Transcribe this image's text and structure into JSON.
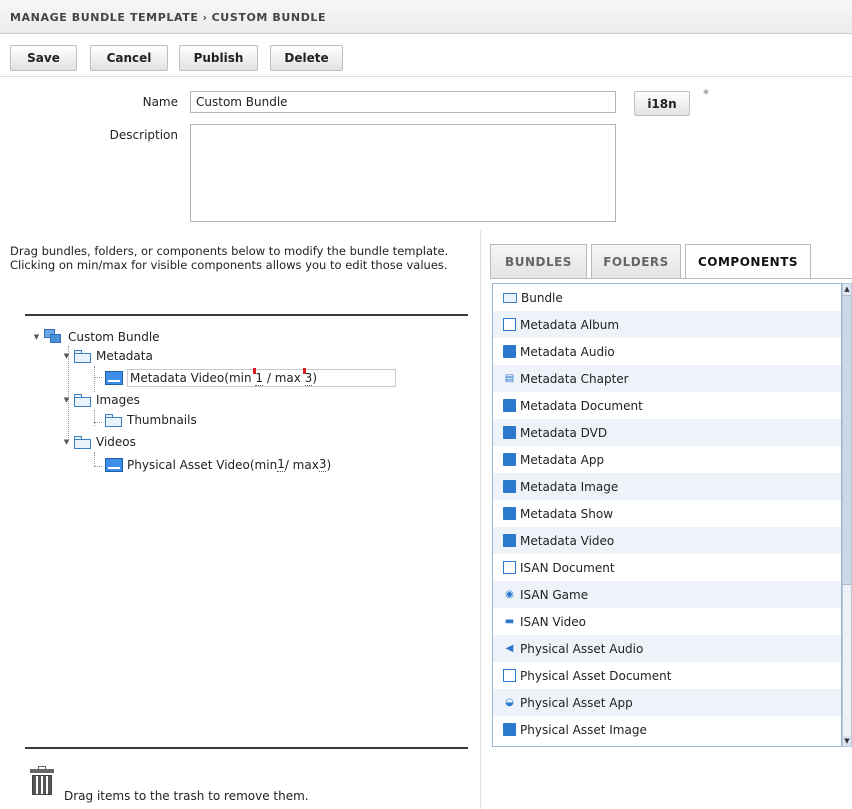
{
  "breadcrumb": {
    "parent": "MANAGE BUNDLE TEMPLATE",
    "separator": "›",
    "current": "CUSTOM BUNDLE"
  },
  "toolbar": {
    "save": "Save",
    "cancel": "Cancel",
    "publish": "Publish",
    "delete": "Delete"
  },
  "form": {
    "name_label": "Name",
    "name_value": "Custom Bundle",
    "i18n_label": "i18n",
    "required_mark": "*",
    "description_label": "Description",
    "description_value": ""
  },
  "instructions": "Drag bundles, folders, or components below to modify the bundle template. Clicking on min/max for visible components allows you to edit those values.",
  "tree": {
    "root": "Custom Bundle",
    "metadata": "Metadata",
    "metadata_video": {
      "prefix": "Metadata Video(min ",
      "min": "1",
      "sep": " / max ",
      "max": "3",
      "suffix": ")"
    },
    "images": "Images",
    "thumbnails": "Thumbnails",
    "videos": "Videos",
    "physical_asset_video": {
      "prefix": "Physical Asset Video(min ",
      "min": "1",
      "sep": " / max ",
      "max": "3",
      "suffix": ")"
    }
  },
  "tabs": {
    "bundles": "BUNDLES",
    "folders": "FOLDERS",
    "components": "COMPONENTS",
    "active": "COMPONENTS"
  },
  "components": [
    {
      "label": "Bundle",
      "icon": "folder-icon"
    },
    {
      "label": "Metadata Album",
      "icon": "album-icon"
    },
    {
      "label": "Metadata Audio",
      "icon": "audio-icon"
    },
    {
      "label": "Metadata Chapter",
      "icon": "chapter-icon"
    },
    {
      "label": "Metadata Document",
      "icon": "document-icon"
    },
    {
      "label": "Metadata DVD",
      "icon": "dvd-icon"
    },
    {
      "label": "Metadata App",
      "icon": "app-icon"
    },
    {
      "label": "Metadata Image",
      "icon": "image-icon"
    },
    {
      "label": "Metadata Show",
      "icon": "show-icon"
    },
    {
      "label": "Metadata Video",
      "icon": "video-icon"
    },
    {
      "label": "ISAN Document",
      "icon": "document-outline-icon"
    },
    {
      "label": "ISAN Game",
      "icon": "game-icon"
    },
    {
      "label": "ISAN Video",
      "icon": "video-icon"
    },
    {
      "label": "Physical Asset Audio",
      "icon": "speaker-icon"
    },
    {
      "label": "Physical Asset Document",
      "icon": "document-outline-icon"
    },
    {
      "label": "Physical Asset App",
      "icon": "app-icon"
    },
    {
      "label": "Physical Asset Image",
      "icon": "image-icon"
    }
  ],
  "trash": {
    "text": "Drag items to the trash to remove them."
  },
  "colors": {
    "accent": "#2a79cf",
    "list_alt_row": "#eef3fa",
    "marker": "#d42020"
  }
}
